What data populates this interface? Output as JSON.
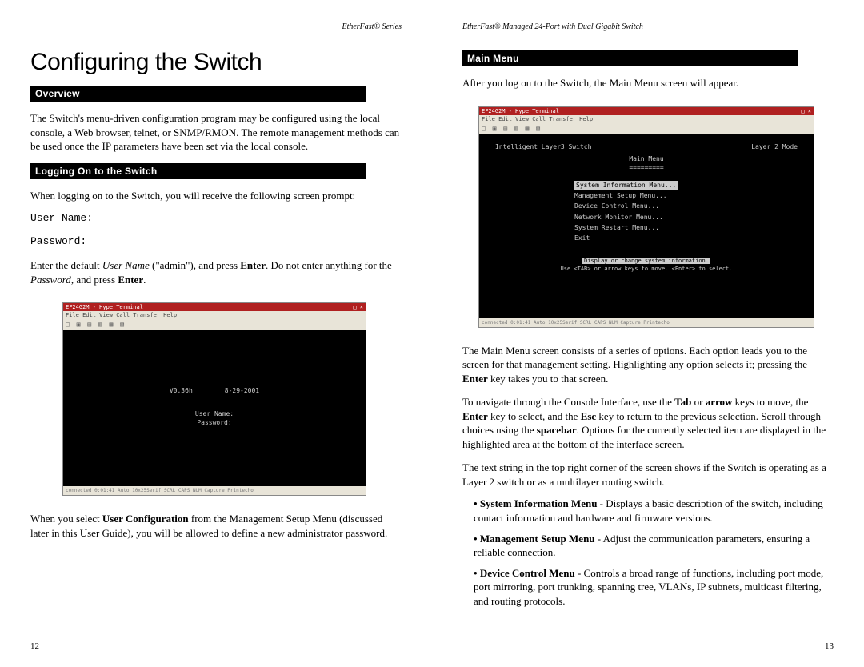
{
  "left": {
    "header": "EtherFast® Series",
    "title": "Configuring the Switch",
    "sec1": "Overview",
    "p1": "The Switch's menu-driven configuration program may be configured using the local console, a Web browser, telnet, or SNMP/RMON. The remote management methods can be used once the IP parameters have been set via the local console.",
    "sec2": "Logging On to the Switch",
    "p2": "When logging on to the Switch, you will receive the following screen prompt:",
    "mono1": "User Name:",
    "mono2": "Password:",
    "p3a": "Enter the default ",
    "p3b_i": "User Name",
    "p3c": " (\"admin\"), and press ",
    "p3d_b": "Enter",
    "p3e": ". Do not enter anything for the ",
    "p3f_i": "Password",
    "p3g": ", and press ",
    "p3h_b": "Enter",
    "p3i": ".",
    "term1": {
      "title": "EF24G2M - HyperTerminal",
      "menu": "File  Edit  View  Call  Transfer  Help",
      "toolbar": "□ ▣ ▤ ▥ ▦ ▧",
      "ver": "V0.36h",
      "date": "8-29-2001",
      "user": "User Name:",
      "pass": "Password:",
      "status": "connected 0:01:41    Auto    10x25Serif    SCRL    CAPS    NUM    Capture    Printecho"
    },
    "p4a": "When you select ",
    "p4b_b": "User Configuration",
    "p4c": " from the Management Setup Menu (discussed later in this User Guide), you will be allowed to define a new administrator password.",
    "pagenum": "12"
  },
  "right": {
    "header": "EtherFast® Managed 24-Port with Dual Gigabit Switch",
    "sec1": "Main Menu",
    "p1": "After you log on to the Switch, the Main Menu screen will appear.",
    "term2": {
      "title": "EF24G2M - HyperTerminal",
      "menu": "File  Edit  View  Call  Transfer  Help",
      "toolbar": "□ ▣ ▤ ▥ ▦ ▧",
      "row_l": "Intelligent Layer3 Switch",
      "row_r": "Layer 2 Mode",
      "mh": "Main Menu",
      "mu": "=========",
      "items": [
        "System Information Menu...",
        "Management Setup Menu...",
        "Device Control Menu...",
        "Network Monitor Menu...",
        "System Restart Menu...",
        "Exit"
      ],
      "hint1": "Display or change system information.",
      "hint2": "Use <TAB> or arrow keys to move. <Enter> to select.",
      "status": "connected 0:01:41    Auto    10x25Serif    SCRL    CAPS    NUM    Capture    Printecho"
    },
    "p2a": "The Main Menu screen consists of a series of options. Each option leads you to the screen for that management setting.  Highlighting any option selects it; pressing the ",
    "p2b_b": "Enter",
    "p2c": " key takes you to that screen.",
    "p3a": "To navigate through the Console Interface, use the ",
    "p3b_b": "Tab",
    "p3c": " or ",
    "p3d_b": "arrow",
    "p3e": " keys to move, the ",
    "p3f_b": "Enter",
    "p3g": " key to select, and the ",
    "p3h_b": "Esc",
    "p3i": " key to return to the previous selection. Scroll through choices using the ",
    "p3j_b": "spacebar",
    "p3k": ". Options for the currently selected item are displayed in the highlighted area at the bottom of the interface screen.",
    "p4": "The text string in the top right corner of the screen shows if the Switch is operating as a Layer 2 switch or as a multilayer routing switch.",
    "b1a_b": "System Information Menu",
    "b1b": " - Displays a basic description of the switch, including contact information and hardware and firmware versions.",
    "b2a_b": "Management Setup Menu",
    "b2b": " - Adjust the communication parameters, ensuring a reliable connection.",
    "b3a_b": "Device Control Menu",
    "b3b": " - Controls a broad range of functions, including port mode, port mirroring, port trunking, spanning tree, VLANs, IP subnets, multicast filtering, and routing protocols.",
    "pagenum": "13"
  }
}
